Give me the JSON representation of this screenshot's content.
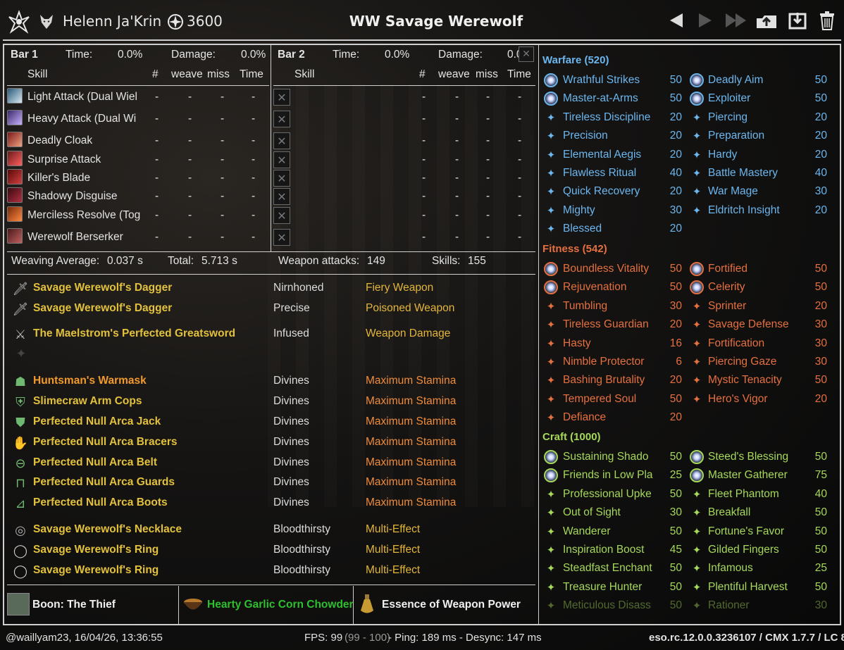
{
  "header": {
    "character": "Helenn Ja'Krin",
    "cp": "3600",
    "build": "WW Savage Werewolf"
  },
  "bars": [
    {
      "label": "Bar 1",
      "time_label": "Time:",
      "time": "0.0%",
      "damage_label": "Damage:",
      "damage": "0.0%",
      "cols": [
        "Skill",
        "#",
        "weave",
        "miss",
        "Time"
      ],
      "skills": [
        "Light Attack (Dual Wiel",
        "Heavy Attack (Dual Wi",
        "Deadly Cloak",
        "Surprise Attack",
        "Killer's Blade",
        "Shadowy Disguise",
        "Merciless Resolve (Tog",
        "Werewolf Berserker"
      ]
    },
    {
      "label": "Bar 2",
      "time_label": "Time:",
      "time": "0.0%",
      "damage_label": "Damage:",
      "damage": "0.0%",
      "cols": [
        "Skill",
        "#",
        "weave",
        "miss",
        "Time"
      ],
      "skills": [
        "",
        "",
        "",
        "",
        "",
        "",
        "",
        ""
      ]
    }
  ],
  "dash": "-",
  "x_mark": "✕",
  "stats": {
    "weave_label": "Weaving Average:",
    "weave": "0.037 s",
    "total_label": "Total:",
    "total": "5.713 s",
    "weapon_label": "Weapon attacks:",
    "weapon": "149",
    "skills_label": "Skills:",
    "skills": "155"
  },
  "gear": [
    {
      "name": "Savage Werewolf's Dagger",
      "trait": "Nirnhoned",
      "enchant": "Fiery Weapon",
      "quality": "gold",
      "icon": "dagger"
    },
    {
      "name": "Savage Werewolf's Dagger",
      "trait": "Precise",
      "enchant": "Poisoned Weapon",
      "quality": "gold",
      "icon": "dagger"
    },
    {
      "name": "The Maelstrom's Perfected Greatsword",
      "trait": "Infused",
      "enchant": "Weapon Damage",
      "quality": "gold",
      "icon": "sword"
    },
    {
      "name": "Huntsman's Warmask",
      "trait": "Divines",
      "enchant": "Maximum Stamina",
      "quality": "orange",
      "icon": "head"
    },
    {
      "name": "Slimecraw Arm Cops",
      "trait": "Divines",
      "enchant": "Maximum Stamina",
      "quality": "gold",
      "icon": "shoulder"
    },
    {
      "name": "Perfected Null Arca Jack",
      "trait": "Divines",
      "enchant": "Maximum Stamina",
      "quality": "gold",
      "icon": "chest"
    },
    {
      "name": "Perfected Null Arca Bracers",
      "trait": "Divines",
      "enchant": "Maximum Stamina",
      "quality": "gold",
      "icon": "hands"
    },
    {
      "name": "Perfected Null Arca Belt",
      "trait": "Divines",
      "enchant": "Maximum Stamina",
      "quality": "gold",
      "icon": "belt"
    },
    {
      "name": "Perfected Null Arca Guards",
      "trait": "Divines",
      "enchant": "Maximum Stamina",
      "quality": "gold",
      "icon": "legs"
    },
    {
      "name": "Perfected Null Arca Boots",
      "trait": "Divines",
      "enchant": "Maximum Stamina",
      "quality": "gold",
      "icon": "feet"
    },
    {
      "name": "Savage Werewolf's Necklace",
      "trait": "Bloodthirsty",
      "enchant": "Multi-Effect",
      "quality": "gold",
      "icon": "neck"
    },
    {
      "name": "Savage Werewolf's Ring",
      "trait": "Bloodthirsty",
      "enchant": "Multi-Effect",
      "quality": "gold",
      "icon": "ring"
    },
    {
      "name": "Savage Werewolf's Ring",
      "trait": "Bloodthirsty",
      "enchant": "Multi-Effect",
      "quality": "gold",
      "icon": "ring"
    }
  ],
  "buffs": {
    "boon": "Boon: The Thief",
    "food": "Hearty Garlic Corn Chowder",
    "drink": "Essence of Weapon Power"
  },
  "cp_tree": [
    {
      "category": "Warfare (520)",
      "color": "#6cb6ee",
      "rows": [
        [
          "Wrathful Strikes",
          "50",
          "Deadly Aim",
          "50"
        ],
        [
          "Master-at-Arms",
          "50",
          "Exploiter",
          "50"
        ],
        [
          "Tireless Discipline",
          "20",
          "Piercing",
          "20"
        ],
        [
          "Precision",
          "20",
          "Preparation",
          "20"
        ],
        [
          "Elemental Aegis",
          "20",
          "Hardy",
          "20"
        ],
        [
          "Flawless Ritual",
          "40",
          "Battle Mastery",
          "40"
        ],
        [
          "Quick Recovery",
          "20",
          "War Mage",
          "30"
        ],
        [
          "Mighty",
          "30",
          "Eldritch Insight",
          "20"
        ],
        [
          "Blessed",
          "20",
          "",
          ""
        ]
      ]
    },
    {
      "category": "Fitness (542)",
      "color": "#e5703f",
      "rows": [
        [
          "Boundless Vitality",
          "50",
          "Fortified",
          "50"
        ],
        [
          "Rejuvenation",
          "50",
          "Celerity",
          "50"
        ],
        [
          "Tumbling",
          "30",
          "Sprinter",
          "20"
        ],
        [
          "Tireless Guardian",
          "20",
          "Savage Defense",
          "30"
        ],
        [
          "Hasty",
          "16",
          "Fortification",
          "30"
        ],
        [
          "Nimble Protector",
          "6",
          "Piercing Gaze",
          "30"
        ],
        [
          "Bashing Brutality",
          "20",
          "Mystic Tenacity",
          "50"
        ],
        [
          "Tempered Soul",
          "50",
          "Hero's Vigor",
          "20"
        ],
        [
          "Defiance",
          "20",
          "",
          ""
        ]
      ]
    },
    {
      "category": "Craft (1000)",
      "color": "#a6d85a",
      "rows": [
        [
          "Sustaining Shado",
          "50",
          "Steed's Blessing",
          "50"
        ],
        [
          "Friends in Low Pla",
          "25",
          "Master Gatherer",
          "75"
        ],
        [
          "Professional Upke",
          "50",
          "Fleet Phantom",
          "40"
        ],
        [
          "Out of Sight",
          "30",
          "Breakfall",
          "50"
        ],
        [
          "Wanderer",
          "50",
          "Fortune's Favor",
          "50"
        ],
        [
          "Inspiration Boost",
          "45",
          "Gilded Fingers",
          "50"
        ],
        [
          "Steadfast Enchant",
          "50",
          "Infamous",
          "25"
        ],
        [
          "Treasure Hunter",
          "50",
          "Plentiful Harvest",
          "50"
        ],
        [
          "Meticulous Disass",
          "50",
          "Rationer",
          "30"
        ]
      ]
    }
  ],
  "footer": {
    "left": "@waillyam23, 16/04/26, 13:36:55",
    "fps": "FPS: 99",
    "fps_range": "(99 - 100)",
    "ping": " - Ping: 189 ms - Desync: 147 ms",
    "version": "eso.rc.12.0.0.3236107 / CMX 1.7.7 / LC 86"
  }
}
